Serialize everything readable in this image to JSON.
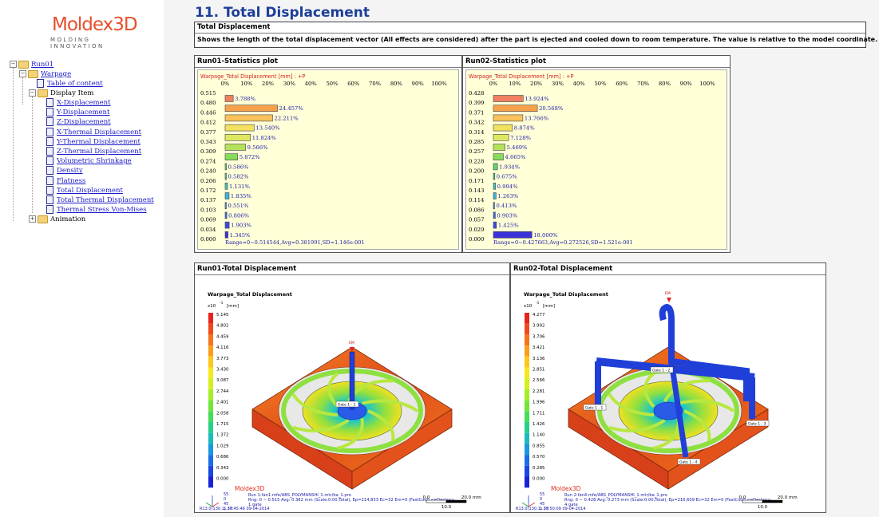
{
  "logo": {
    "brand_a": "Moldex",
    "brand_b": "3D",
    "tagline": "MOLDING INNOVATION"
  },
  "tree": {
    "root": "Run01",
    "warpage": "Warpage",
    "toc": "Table of content",
    "display_item": "Display Item",
    "items": [
      "X-Displacement",
      "Y-Displacement",
      "Z-Displacement",
      "X-Thermal Displacement",
      "Y-Thermal Displacement",
      "Z-Thermal Displacement",
      "Volumetric Shrinkage",
      "Density",
      "Flatness",
      "Total Displacement",
      "Total Thermal Displacement",
      "Thermal Stress Von-Mises"
    ],
    "animation": "Animation"
  },
  "page_title": "11. Total Displacement",
  "description": {
    "header": "Total Displacement",
    "text": "Shows the length of the total displacement vector (All effects are considered) after the part is ejected and cooled down to room temperature. The value is relative to the model coordinate."
  },
  "stats": [
    {
      "panel_title": "Run01-Statistics plot",
      "variable": "Warpage_Total Displacement [mm] : +P",
      "pct_ticks": [
        "0%",
        "10%",
        "20%",
        "30%",
        "40%",
        "50%",
        "60%",
        "70%",
        "80%",
        "90%",
        "100%"
      ],
      "levels": [
        "0.515",
        "0.480",
        "0.446",
        "0.412",
        "0.377",
        "0.343",
        "0.309",
        "0.274",
        "0.240",
        "0.206",
        "0.172",
        "0.137",
        "0.103",
        "0.069",
        "0.034",
        "0.000"
      ],
      "values": [
        3.788,
        24.457,
        22.211,
        13.54,
        11.824,
        9.566,
        5.872,
        0.586,
        0.582,
        1.131,
        1.835,
        0.551,
        0.806,
        1.903,
        1.345
      ],
      "labels": [
        "3.788%",
        "24.457%",
        "22.211%",
        "13.540%",
        "11.824%",
        "9.566%",
        "5.872%",
        "0.586%",
        "0.582%",
        "1.131%",
        "1.835%",
        "0.551%",
        "0.806%",
        "1.903%",
        "1.345%"
      ],
      "range": "Range=0~0.514544,Avg=0.381991,SD=1.146e-001"
    },
    {
      "panel_title": "Run02-Statistics plot",
      "variable": "Warpage_Total Displacement [mm] : +P",
      "pct_ticks": [
        "0%",
        "10%",
        "20%",
        "30%",
        "40%",
        "50%",
        "60%",
        "70%",
        "80%",
        "90%",
        "100%"
      ],
      "levels": [
        "0.428",
        "0.399",
        "0.371",
        "0.342",
        "0.314",
        "0.285",
        "0.257",
        "0.228",
        "0.200",
        "0.171",
        "0.143",
        "0.114",
        "0.086",
        "0.057",
        "0.029",
        "0.000"
      ],
      "values": [
        13.924,
        20.568,
        13.766,
        8.874,
        7.128,
        5.469,
        4.665,
        1.934,
        0.675,
        0.994,
        1.263,
        0.413,
        0.903,
        1.425,
        18.0
      ],
      "labels": [
        "13.924%",
        "20.568%",
        "13.766%",
        "8.874%",
        "7.128%",
        "5.469%",
        "4.665%",
        "1.934%",
        "0.675%",
        "0.994%",
        "1.263%",
        "0.413%",
        "0.903%",
        "1.425%",
        "18.000%"
      ],
      "range": "Range=0~0.427663,Avg=0.272526,SD=1.521e-001"
    }
  ],
  "views": [
    {
      "panel_title": "Run01-Total Displacement",
      "result_name": "Warpage_Total Displacement",
      "scale_prefix": "x10",
      "scale_exp": "-1",
      "unit": "[mm]",
      "legend": [
        "5.145",
        "4.802",
        "4.459",
        "4.116",
        "3.773",
        "3.430",
        "3.087",
        "2.744",
        "2.401",
        "2.058",
        "1.715",
        "1.372",
        "1.029",
        "0.686",
        "0.343",
        "0.000"
      ],
      "gate_labels": [
        "Gate 1 - 1"
      ],
      "em_label": "EM",
      "brand": "Moldex3D",
      "view_angles": "55\n0\n45\n1.30",
      "info_line1": "Run 1:fan1.mfe/ABS_POLYMANSHI_1.mtr/ba_1.pro",
      "info_line2": "Rng: 0 ~ 0.515  Avg: 0.382 mm (Scale:0.00,Total), Ep=214,833 Ec=32 Em=0 (FastCool) <eDesign>",
      "info_line3": "1 gate",
      "scale_bar": [
        "0.0",
        "20.0",
        "mm",
        "10.0"
      ],
      "footer": "R13.0(130.1) 17:45:46 09-04-2014"
    },
    {
      "panel_title": "Run02-Total Displacement",
      "result_name": "Warpage_Total Displacement",
      "scale_prefix": "x10",
      "scale_exp": "-1",
      "unit": "[mm]",
      "legend": [
        "4.277",
        "3.992",
        "3.706",
        "3.421",
        "3.136",
        "2.851",
        "2.566",
        "2.281",
        "1.996",
        "1.711",
        "1.426",
        "1.140",
        "0.855",
        "0.570",
        "0.285",
        "0.000"
      ],
      "gate_labels": [
        "Gate 1 - 1",
        "Gate 1 - 2",
        "Gate 1 - 3",
        "Gate 1 - 4"
      ],
      "em_label": "EM",
      "brand": "Moldex3D",
      "view_angles": "55\n0\n45\n1.30",
      "info_line1": "Run 2:fan4.mfe/ABS_POLYMANSHI_1.mtr/ba_1.pro",
      "info_line2": "Rng: 0 ~ 0.428  Avg: 0.273 mm (Scale:0.00,Total), Ep=216,609 Ec=32 Em=0 (FastCool) <eDesign>",
      "info_line3": "4 gate",
      "scale_bar": [
        "0.0",
        "20.0",
        "mm",
        "10.0"
      ],
      "footer": "R13.0(130.1) 17:50:09 09-04-2014"
    }
  ],
  "colors": {
    "title": "#1d3f99",
    "link": "#1a1ac8",
    "stat_bg": "#ffffd8"
  }
}
